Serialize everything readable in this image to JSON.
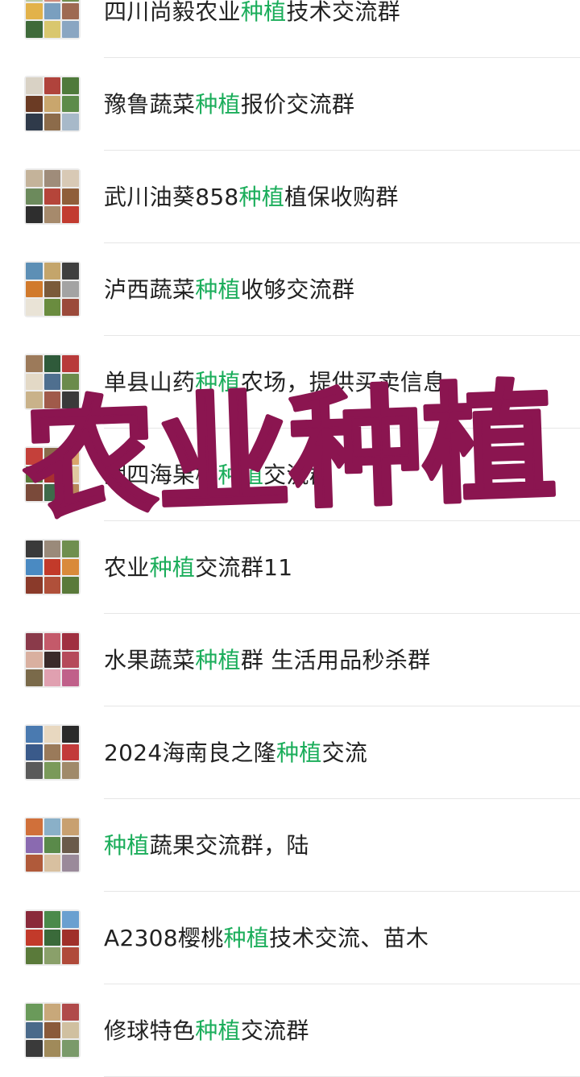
{
  "groups": [
    {
      "pre": "四川尚毅农业",
      "hl": "种植",
      "post": "技术交流群"
    },
    {
      "pre": "豫鲁蔬菜",
      "hl": "种植",
      "post": "报价交流群"
    },
    {
      "pre": "武川油葵858",
      "hl": "种植",
      "post": "植保收购群"
    },
    {
      "pre": "泸西蔬菜",
      "hl": "种植",
      "post": "收够交流群"
    },
    {
      "pre": "单县山药",
      "hl": "种植",
      "post": "农场，提供买卖信息"
    },
    {
      "pre": "湖四海果树",
      "hl": "种植",
      "post": "交流群"
    },
    {
      "pre": "农业",
      "hl": "种植",
      "post": "交流群11"
    },
    {
      "pre": "水果蔬菜",
      "hl": "种植",
      "post": "群 生活用品秒杀群"
    },
    {
      "pre": "2024海南良之隆",
      "hl": "种植",
      "post": "交流"
    },
    {
      "pre": "",
      "hl": "种植",
      "post": "蔬果交流群，陆"
    },
    {
      "pre": "A2308樱桃",
      "hl": "种植",
      "post": "技术交流、苗木"
    },
    {
      "pre": "修球特色",
      "hl": "种植",
      "post": "交流群"
    }
  ],
  "overlay_text": "农业种植",
  "colors": {
    "highlight": "#1aad5a",
    "overlay": "#8b1550",
    "text": "#222222",
    "divider": "#e6e6e6"
  }
}
